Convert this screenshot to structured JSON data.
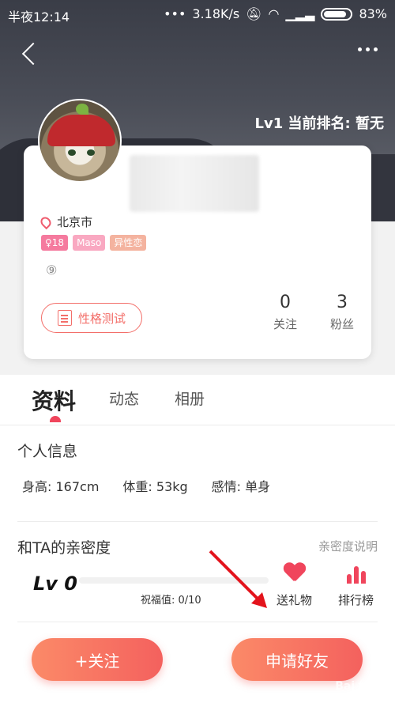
{
  "status_bar": {
    "time": "半夜12:14",
    "network_speed": "3.18K/s",
    "battery": "83%"
  },
  "header": {
    "rank_text": "Lv1   当前排名: 暂无"
  },
  "profile": {
    "location": "北京市",
    "tags": [
      "♀18",
      "Maso",
      "异性恋"
    ],
    "circled_number": "⑨",
    "personality_test_label": "性格测试",
    "following_count": "0",
    "following_label": "关注",
    "fans_count": "3",
    "fans_label": "粉丝"
  },
  "tabs": [
    "资料",
    "动态",
    "相册"
  ],
  "personal_info": {
    "title": "个人信息",
    "height": "身高: 167cm",
    "weight": "体重: 53kg",
    "relationship": "感情: 单身"
  },
  "intimacy": {
    "title": "和TA的亲密度",
    "help_link": "亲密度说明",
    "level": "Lv 0",
    "blessing": "祝福值: 0/10",
    "progress_fraction": 0,
    "send_gift_label": "送礼物",
    "leaderboard_label": "排行榜"
  },
  "buttons": {
    "follow": "+关注",
    "add_friend": "申请好友"
  },
  "watermark": "Bai 经验",
  "colors": {
    "accent": "#f36f6a",
    "pink": "#f0455c"
  }
}
